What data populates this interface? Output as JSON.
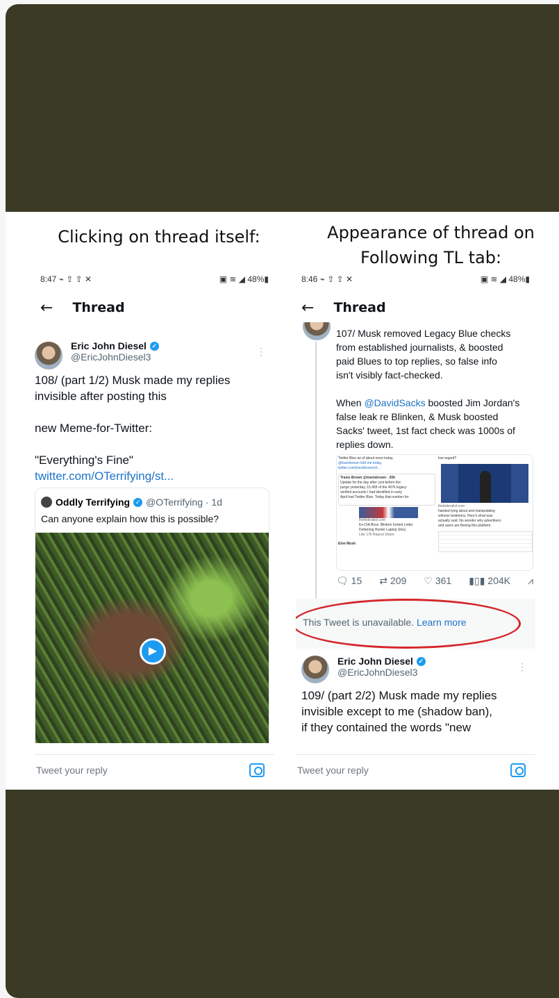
{
  "captions": {
    "left": "Clicking on thread itself:",
    "right_line1": "Appearance of thread on",
    "right_line2": "Following TL tab:"
  },
  "left_screen": {
    "status_time": "8:47",
    "status_right": "48%",
    "header_title": "Thread",
    "tweet": {
      "name": "Eric John Diesel",
      "handle": "@EricJohnDiesel3",
      "text_l1": "108/ (part 1/2) Musk made my replies",
      "text_l2": "invisible after posting this",
      "text_l3": "new Meme-for-Twitter:",
      "text_l4": "\"Everything's Fine\"",
      "link": "twitter.com/OTerrifying/st..."
    },
    "quote": {
      "name": "Oddly Terrifying",
      "handle_time": "@OTerrifying · 1d",
      "text": "Can anyone explain how this is possible?"
    },
    "reply_placeholder": "Tweet your reply"
  },
  "right_screen": {
    "status_time": "8:46",
    "status_right": "48%",
    "header_title": "Thread",
    "tweet107": {
      "l1": "107/ Musk removed Legacy Blue checks",
      "l2": "from established journalists, & boosted",
      "l3": "paid Blues to top replies, so false info",
      "l4": "isn't  visibly fact-checked.",
      "p2_mention": "@DavidSacks",
      "p2_l1_pre": "When ",
      "p2_l1_post": " boosted Jim Jordan's",
      "p2_l2": "false leak re Blinken, & Musk boosted",
      "p2_l3": "Sacks' tweet, 1st fact check was 1000s of",
      "p2_l4": "replies down."
    },
    "embed_left": {
      "t1": "Twitter Blue as of about noon today,",
      "t2": "@travisbrown told me today,",
      "t3": "twitter.com/travisbrown/st...",
      "sub_name": "Travis Brown @travisbrown · 20h",
      "sub1": "Update for the day after: just before the",
      "sub2": "purge yesterday, 15,459 of the 407k legacy",
      "sub3": "verified accounts I had identified in early",
      "sub4": "April had Twitter Blue. Today that number for",
      "src1": "thefederalist.com",
      "src2": "Ex-CIA Boss: Blinken Incited Letter",
      "src3": "Defaming Hunter Laptop Story",
      "stats": "Like 17k Repost Share",
      "elon": "Elon Musk"
    },
    "embed_right": {
      "t1": "low regard?",
      "c1": "handed lying about and manipulating",
      "c2": "witness testimony. Here's what was",
      "c3": "actually said. No wonder why advertisers",
      "c4": "and users are fleeing this platform.",
      "src": "thefederalist.com"
    },
    "actions": {
      "replies": "15",
      "retweets": "209",
      "likes": "361",
      "views": "204K"
    },
    "unavailable_text": "This Tweet is unavailable.",
    "learn_more": "Learn more",
    "tweet109": {
      "name": "Eric John Diesel",
      "handle": "@EricJohnDiesel3",
      "l1": "109/ (part 2/2) Musk made my replies",
      "l2": "invisible except to me (shadow ban),",
      "l3": "if they contained the words \"new"
    },
    "reply_placeholder": "Tweet your reply"
  },
  "colors": {
    "background": "#3b3a25",
    "link": "#1d73c9",
    "verified": "#1d9bf0",
    "highlight_ring": "#d6262b"
  }
}
